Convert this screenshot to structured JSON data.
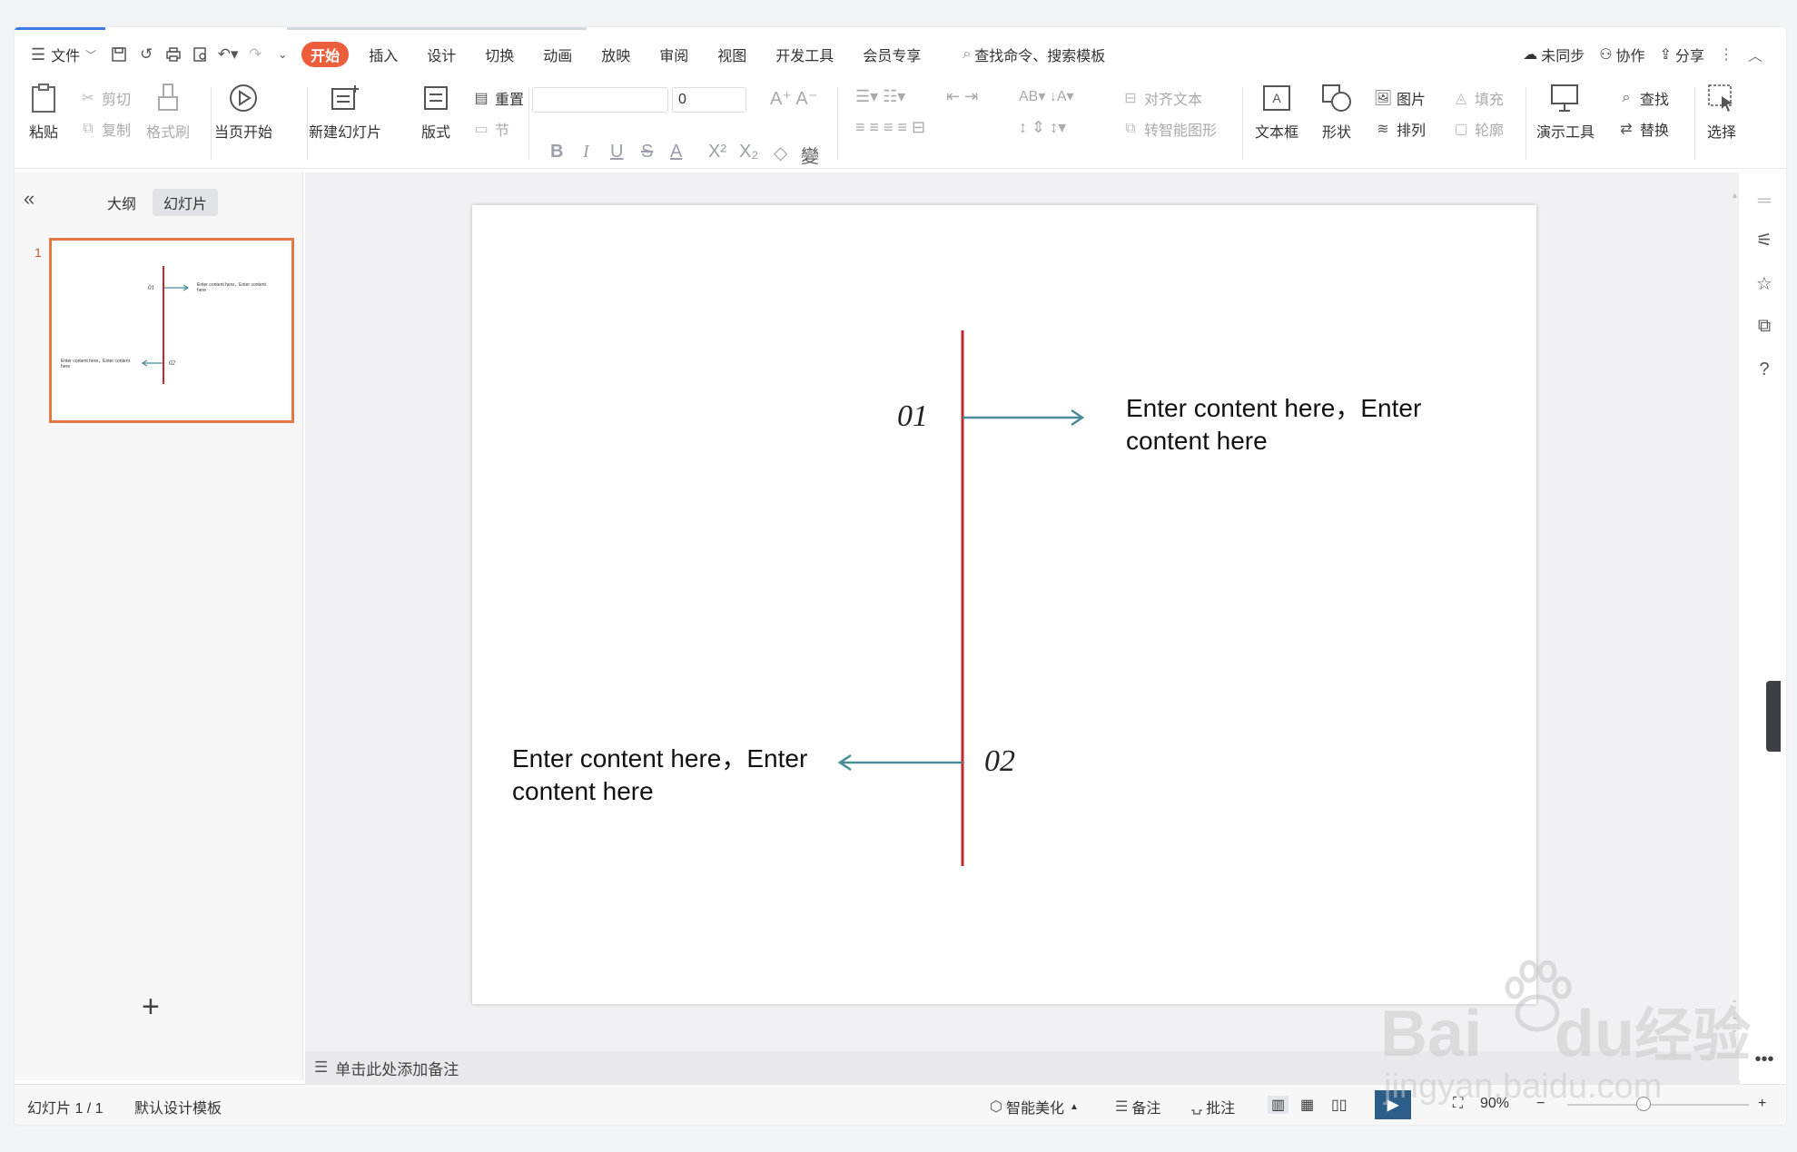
{
  "menubar": {
    "file_label": "文件",
    "tabs": [
      "开始",
      "插入",
      "设计",
      "切换",
      "动画",
      "放映",
      "审阅",
      "视图",
      "开发工具",
      "会员专享"
    ],
    "active_tab": "开始",
    "search_placeholder": "查找命令、搜索模板",
    "unsynced": "未同步",
    "collab": "协作",
    "share": "分享"
  },
  "ribbon": {
    "paste": "粘贴",
    "cut": "剪切",
    "copy": "复制",
    "format_painter": "格式刷",
    "from_current": "当页开始",
    "new_slide": "新建幻灯片",
    "layout": "版式",
    "reset": "重置",
    "section": "节",
    "font_size": "0",
    "align_text": "对齐文本",
    "smart_shape": "转智能图形",
    "textbox": "文本框",
    "shape": "形状",
    "picture": "图片",
    "arrange": "排列",
    "fill": "填充",
    "outline": "轮廓",
    "present_tools": "演示工具",
    "find": "查找",
    "replace": "替换",
    "select": "选择"
  },
  "panel": {
    "outline_tab": "大纲",
    "slides_tab": "幻灯片",
    "slide_number": "1",
    "thumb_text": "Enter content here，Enter content here",
    "thumb_num1": "01",
    "thumb_num2": "02"
  },
  "slide": {
    "num1": "01",
    "num2": "02",
    "text1_line1": "Enter content here，Enter",
    "text1_line2": "content here",
    "text2_line1": "Enter content here，Enter",
    "text2_line2": "content here",
    "timeline_color": "#c0282d",
    "arrow_color": "#4a8a96"
  },
  "notes": {
    "placeholder": "单击此处添加备注"
  },
  "status": {
    "slide_count": "幻灯片 1 / 1",
    "template": "默认设计模板",
    "beautify": "智能美化",
    "notes": "备注",
    "comment": "批注",
    "zoom": "90%"
  },
  "watermark": {
    "brand": "Bai",
    "brand2": "du",
    "cn": "经验",
    "url": "jingyan.baidu.com"
  },
  "colors": {
    "accent": "#ec5d3c",
    "thumb_border": "#e37845"
  }
}
